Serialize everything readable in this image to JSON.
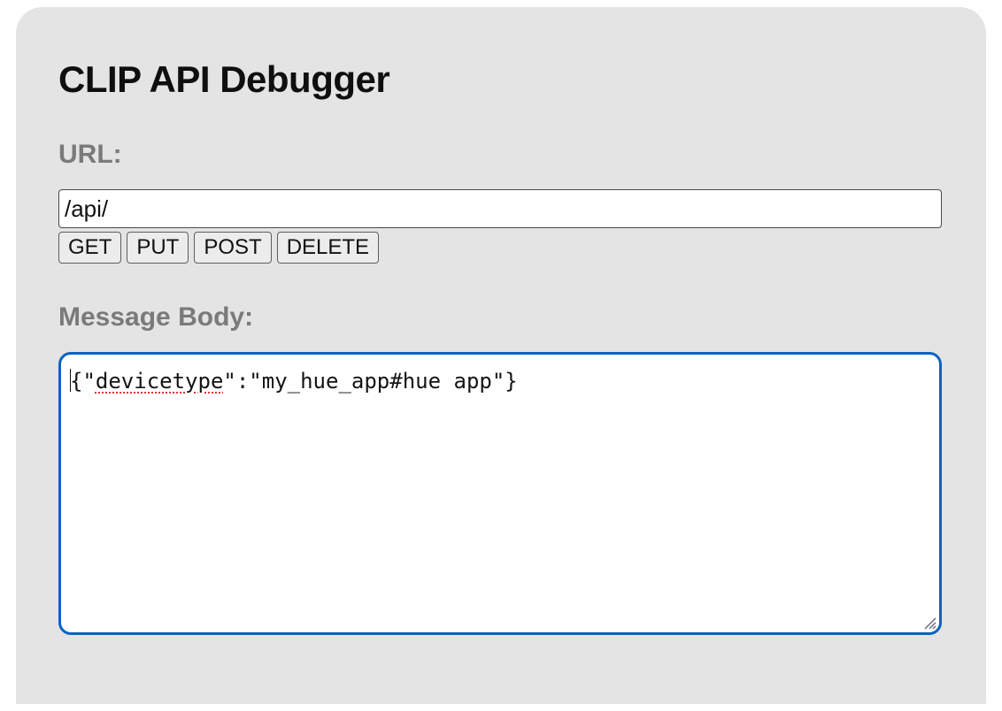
{
  "title": "CLIP API Debugger",
  "url": {
    "label": "URL:",
    "value": "/api/"
  },
  "methods": {
    "get": "GET",
    "put": "PUT",
    "post": "POST",
    "delete": "DELETE"
  },
  "message_body": {
    "label": "Message Body:",
    "value": "{\"devicetype\":\"my_hue_app#hue app\"}"
  }
}
